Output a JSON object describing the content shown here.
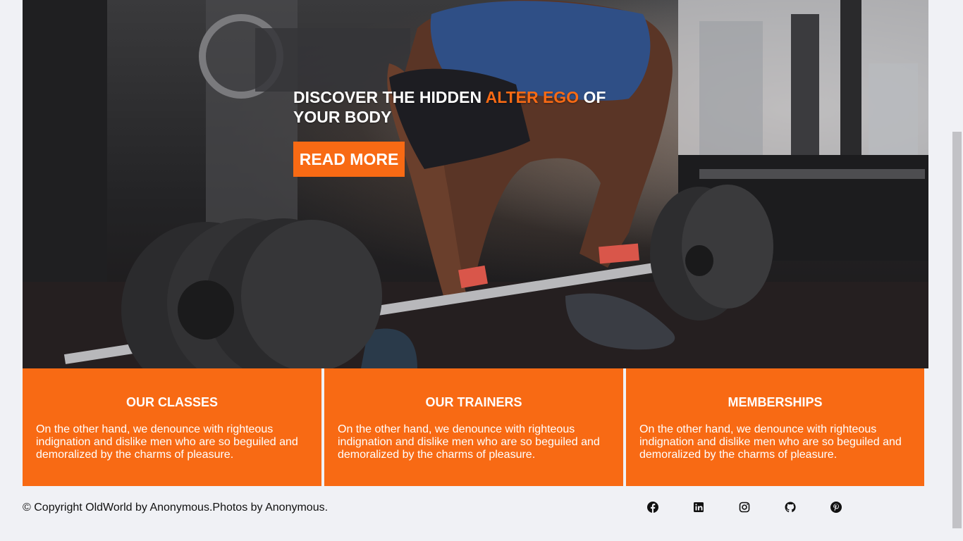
{
  "hero": {
    "headline_part1": "Discover the hidden ",
    "headline_accent": "alter ego",
    "headline_part2": " of your body",
    "cta_label": "READ MORE",
    "accent_color": "#f86a14"
  },
  "cards": [
    {
      "title": "OUR CLASSES",
      "text": "On the other hand, we denounce with righteous indignation and dislike men who are so beguiled and demoralized by the charms of pleasure."
    },
    {
      "title": "OUR TRAINERS",
      "text": "On the other hand, we denounce with righteous indignation and dislike men who are so beguiled and demoralized by the charms of pleasure."
    },
    {
      "title": "MEMBERSHIPS",
      "text": "On the other hand, we denounce with righteous indignation and dislike men who are so beguiled and demoralized by the charms of pleasure."
    }
  ],
  "footer": {
    "copyright": "© Copyright OldWorld by Anonymous.Photos by Anonymous.",
    "social_icons": [
      "facebook-icon",
      "linkedin-icon",
      "instagram-icon",
      "github-icon",
      "pinterest-icon"
    ]
  },
  "colors": {
    "card_bg": "#f86a14",
    "page_bg": "#f0f1f5"
  }
}
